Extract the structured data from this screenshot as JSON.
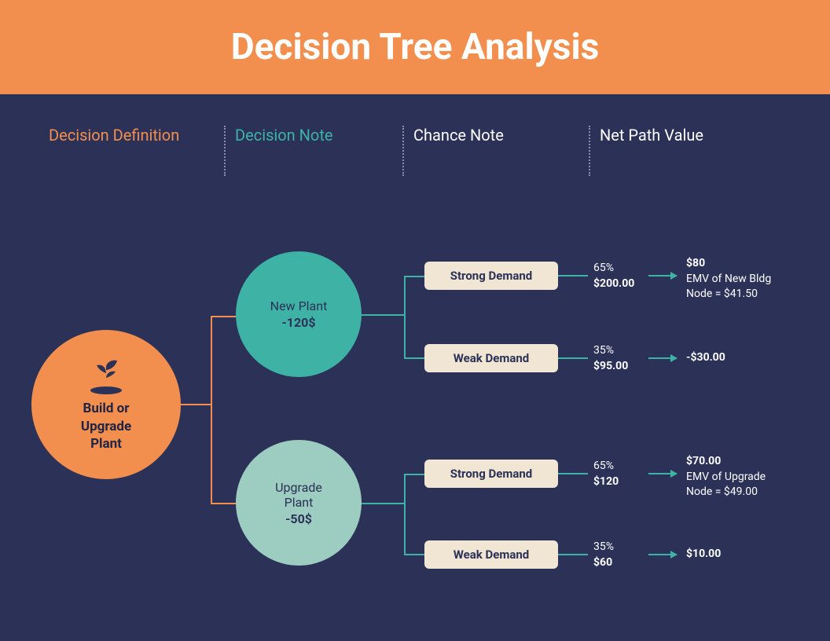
{
  "title": "Decision Tree Analysis",
  "columns": {
    "c1": "Decision Definition",
    "c2": "Decision Note",
    "c3": "Chance Note",
    "c4": "Net Path Value"
  },
  "root": {
    "label": "Build or\nUpgrade\nPlant"
  },
  "nodes": {
    "new_plant": {
      "name": "New Plant",
      "cost": "-120$"
    },
    "upgrade_plant": {
      "name": "Upgrade\nPlant",
      "cost": "-50$"
    }
  },
  "chances": [
    {
      "label": "Strong Demand",
      "pct": "65%",
      "amount": "$200.00",
      "net_main": "$80",
      "net_sub1": "EMV of New Bldg",
      "net_sub2": "Node = $41.50"
    },
    {
      "label": "Weak Demand",
      "pct": "35%",
      "amount": "$95.00",
      "net_main": "-$30.00",
      "net_sub1": "",
      "net_sub2": ""
    },
    {
      "label": "Strong Demand",
      "pct": "65%",
      "amount": "$120",
      "net_main": "$70.00",
      "net_sub1": "EMV of Upgrade",
      "net_sub2": "Node = $49.00"
    },
    {
      "label": "Weak Demand",
      "pct": "35%",
      "amount": "$60",
      "net_main": "$10.00",
      "net_sub1": "",
      "net_sub2": ""
    }
  ],
  "chart_data": {
    "type": "decision-tree",
    "root": {
      "label": "Build or Upgrade Plant"
    },
    "decisions": [
      {
        "name": "New Plant",
        "cost": -120,
        "emv": 41.5,
        "chances": [
          {
            "label": "Strong Demand",
            "probability": 0.65,
            "payoff": 200.0,
            "net": 80
          },
          {
            "label": "Weak Demand",
            "probability": 0.35,
            "payoff": 95.0,
            "net": -30.0
          }
        ]
      },
      {
        "name": "Upgrade Plant",
        "cost": -50,
        "emv": 49.0,
        "chances": [
          {
            "label": "Strong Demand",
            "probability": 0.65,
            "payoff": 120,
            "net": 70.0
          },
          {
            "label": "Weak Demand",
            "probability": 0.35,
            "payoff": 60,
            "net": 10.0
          }
        ]
      }
    ]
  }
}
